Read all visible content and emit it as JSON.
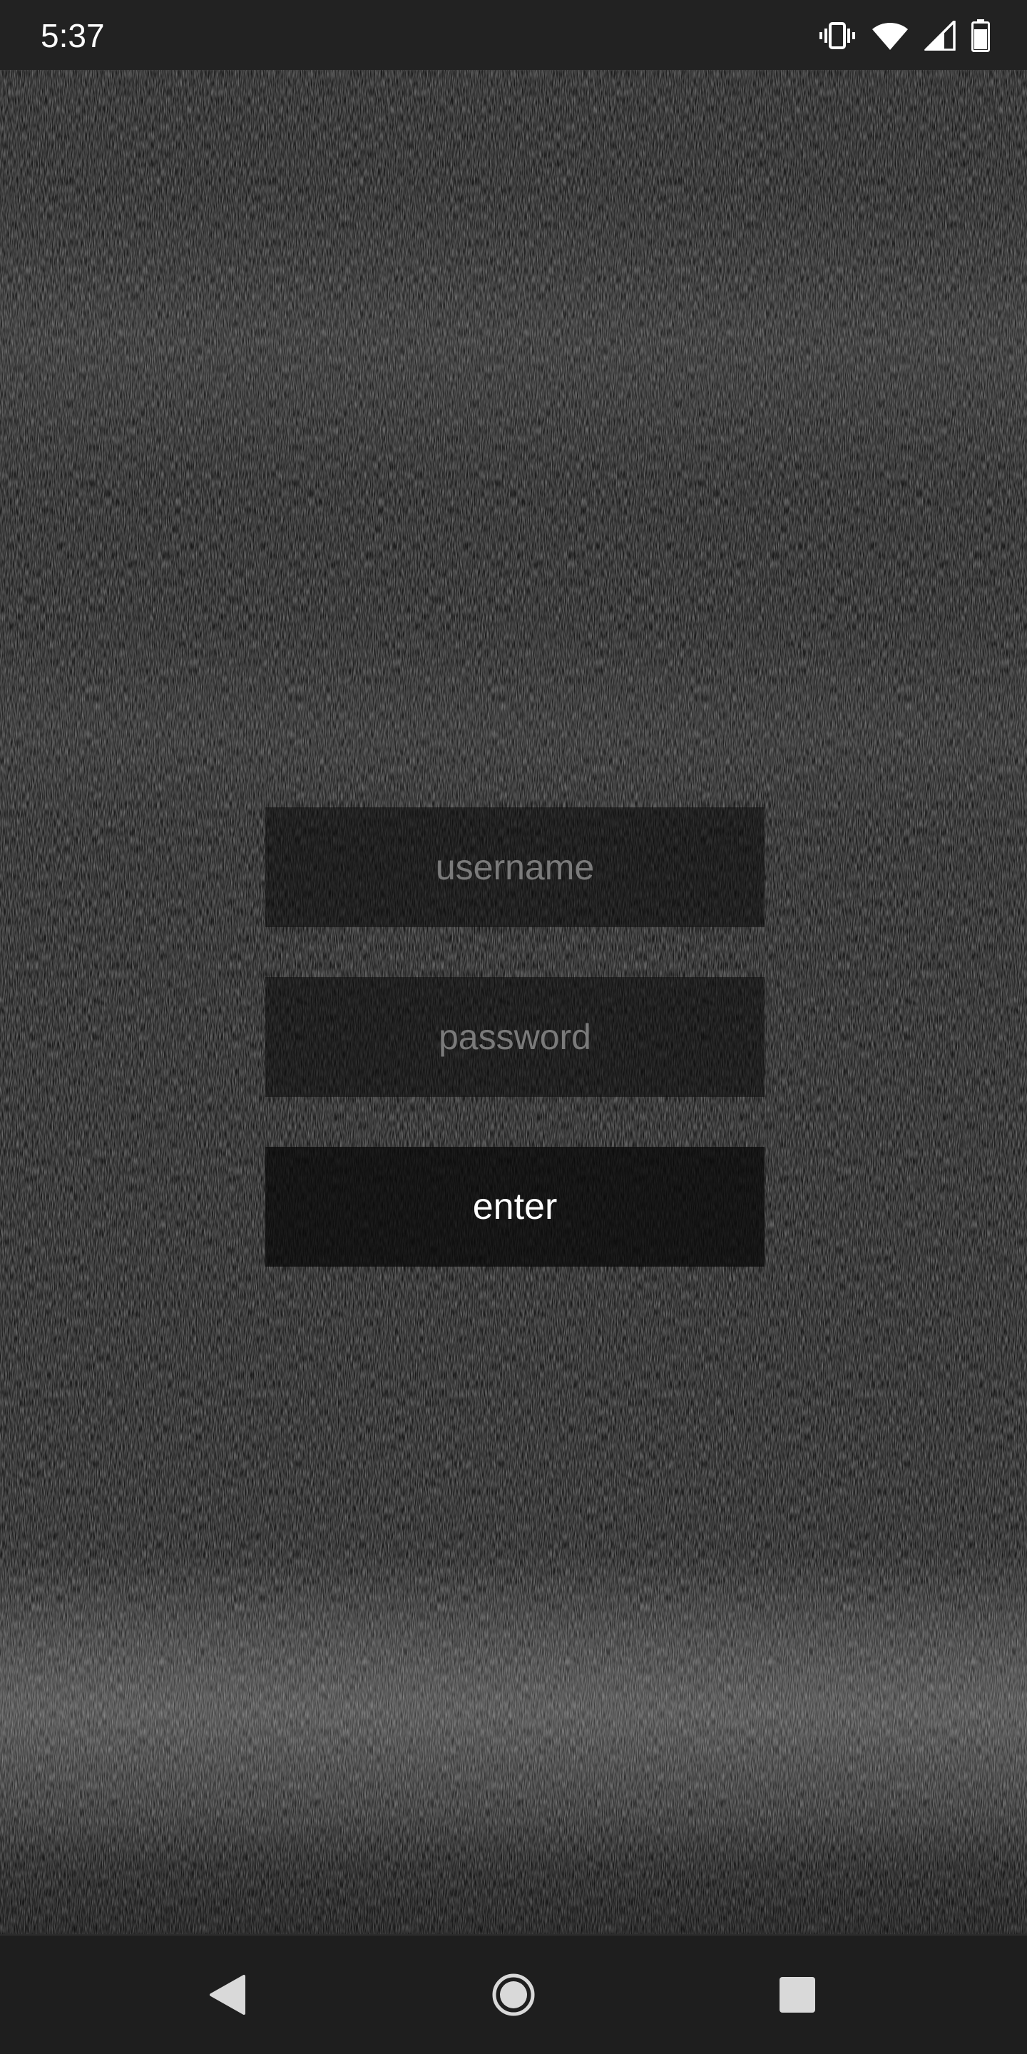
{
  "status_bar": {
    "time": "5:37",
    "icons": [
      "vibrate-icon",
      "wifi-icon",
      "cell-signal-icon",
      "battery-icon"
    ]
  },
  "login": {
    "username_placeholder": "username",
    "username_value": "",
    "password_placeholder": "password",
    "password_value": "",
    "enter_label": "enter"
  },
  "nav_bar": {
    "icons": [
      "back-icon",
      "home-icon",
      "recents-icon"
    ]
  },
  "colors": {
    "status_bar_bg": "#222222",
    "nav_bar_bg": "#1e1e1e",
    "field_bg": "#0a0a0a",
    "placeholder_text": "#7a7a7a",
    "button_text": "#ffffff"
  }
}
